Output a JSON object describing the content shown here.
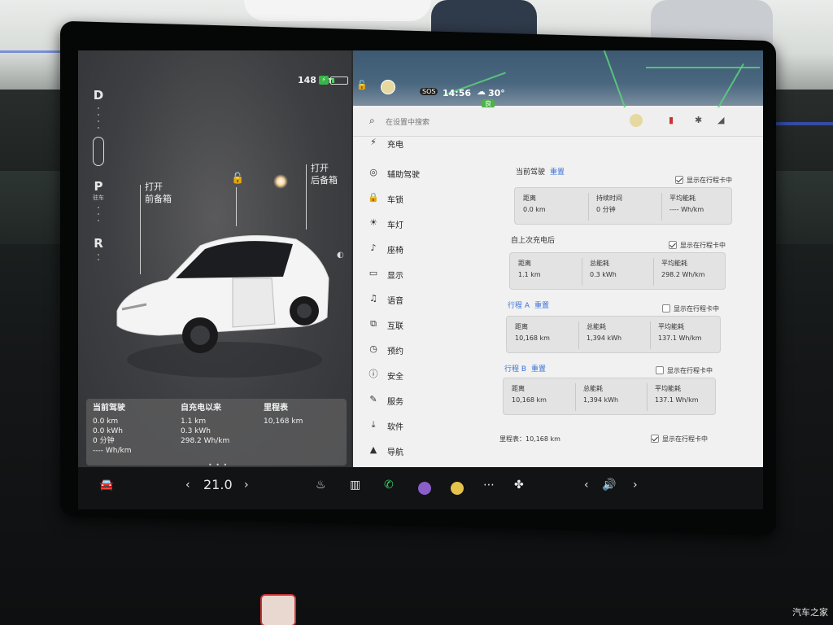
{
  "car": {
    "gears": [
      "D",
      "P",
      "R"
    ],
    "gear_sub": "驻车",
    "range": "148 km",
    "battery_fraction": 0.15,
    "colors": {
      "battery": "#4bd35a",
      "accent": "#3d73d6"
    },
    "front_trunk": {
      "line1": "打开",
      "line2": "前备箱"
    },
    "rear_trunk": {
      "line1": "打开",
      "line2": "后备箱"
    },
    "stats": {
      "current": {
        "header": "当前驾驶",
        "distance": "0.0 km",
        "energy": "0.0 kWh",
        "duration": "0 分钟",
        "avg": "---- Wh/km"
      },
      "since_charge": {
        "header": "自充电以来",
        "distance": "1.1 km",
        "energy": "0.3 kWh",
        "avg": "298.2 Wh/km"
      },
      "odometer": {
        "header": "里程表",
        "value": "10,168 km"
      }
    },
    "page_dots": "• • •"
  },
  "status": {
    "time": "14:56",
    "temp": "30°",
    "air_quality": "良",
    "sos": "SOS"
  },
  "search": {
    "placeholder": "在设置中搜索"
  },
  "nav": [
    {
      "icon": "⚡",
      "label": "充电"
    },
    {
      "icon": "◎",
      "label": "辅助驾驶"
    },
    {
      "icon": "🔒",
      "label": "车锁"
    },
    {
      "icon": "☀",
      "label": "车灯"
    },
    {
      "icon": "♪",
      "label": "座椅"
    },
    {
      "icon": "▭",
      "label": "显示"
    },
    {
      "icon": "♫",
      "label": "语音"
    },
    {
      "icon": "⧉",
      "label": "互联"
    },
    {
      "icon": "◷",
      "label": "预约"
    },
    {
      "icon": "ⓘ",
      "label": "安全"
    },
    {
      "icon": "✎",
      "label": "服务"
    },
    {
      "icon": "⤓",
      "label": "软件"
    },
    {
      "icon": "▲",
      "label": "导航"
    }
  ],
  "trips": {
    "show_label": "显示在行程卡中",
    "reset_label": "重置",
    "current": {
      "title": "当前驾驶",
      "show": true,
      "cells": [
        {
          "k": "距离",
          "v": "0.0 km"
        },
        {
          "k": "持续时间",
          "v": "0 分钟"
        },
        {
          "k": "平均能耗",
          "v": "---- Wh/km"
        }
      ]
    },
    "since_charge": {
      "title": "自上次充电后",
      "show": true,
      "cells": [
        {
          "k": "距离",
          "v": "1.1 km"
        },
        {
          "k": "总能耗",
          "v": "0.3 kWh"
        },
        {
          "k": "平均能耗",
          "v": "298.2 Wh/km"
        }
      ]
    },
    "trip_a": {
      "title": "行程 A",
      "show": false,
      "cells": [
        {
          "k": "距离",
          "v": "10,168 km"
        },
        {
          "k": "总能耗",
          "v": "1,394 kWh"
        },
        {
          "k": "平均能耗",
          "v": "137.1 Wh/km"
        }
      ]
    },
    "trip_b": {
      "title": "行程 B",
      "show": false,
      "cells": [
        {
          "k": "距离",
          "v": "10,168 km"
        },
        {
          "k": "总能耗",
          "v": "1,394 kWh"
        },
        {
          "k": "平均能耗",
          "v": "137.1 Wh/km"
        }
      ]
    },
    "odometer": {
      "label": "里程表：10,168 km",
      "show": true
    }
  },
  "bottom": {
    "temp": "21.0",
    "left_arrow": "‹",
    "right_arrow": "›"
  },
  "watermark": "汽车之家"
}
